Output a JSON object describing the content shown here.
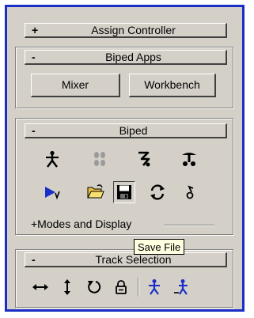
{
  "rollouts": {
    "assign_controller": {
      "sign": "+",
      "title": "Assign Controller"
    },
    "biped_apps": {
      "sign": "-",
      "title": "Biped Apps",
      "mixer_label": "Mixer",
      "workbench_label": "Workbench"
    },
    "biped": {
      "sign": "-",
      "title": "Biped",
      "modes_label": "+Modes and Display"
    },
    "track_selection": {
      "sign": "-",
      "title": "Track Selection"
    }
  },
  "tooltip": {
    "text": "Save File"
  },
  "icons": {
    "biped_row1": [
      "figure-mode-icon",
      "footstep-mode-icon",
      "motion-flow-mode-icon",
      "mixer-mode-icon"
    ],
    "biped_row2": [
      "playback-icon",
      "open-file-icon",
      "save-file-icon",
      "load-fig-file-icon",
      "buffer-icon"
    ],
    "track": [
      "move-horizontal-icon",
      "move-vertical-icon",
      "rotate-icon",
      "lock-icon",
      "select-symmetrical-icon",
      "select-opposite-icon"
    ]
  }
}
